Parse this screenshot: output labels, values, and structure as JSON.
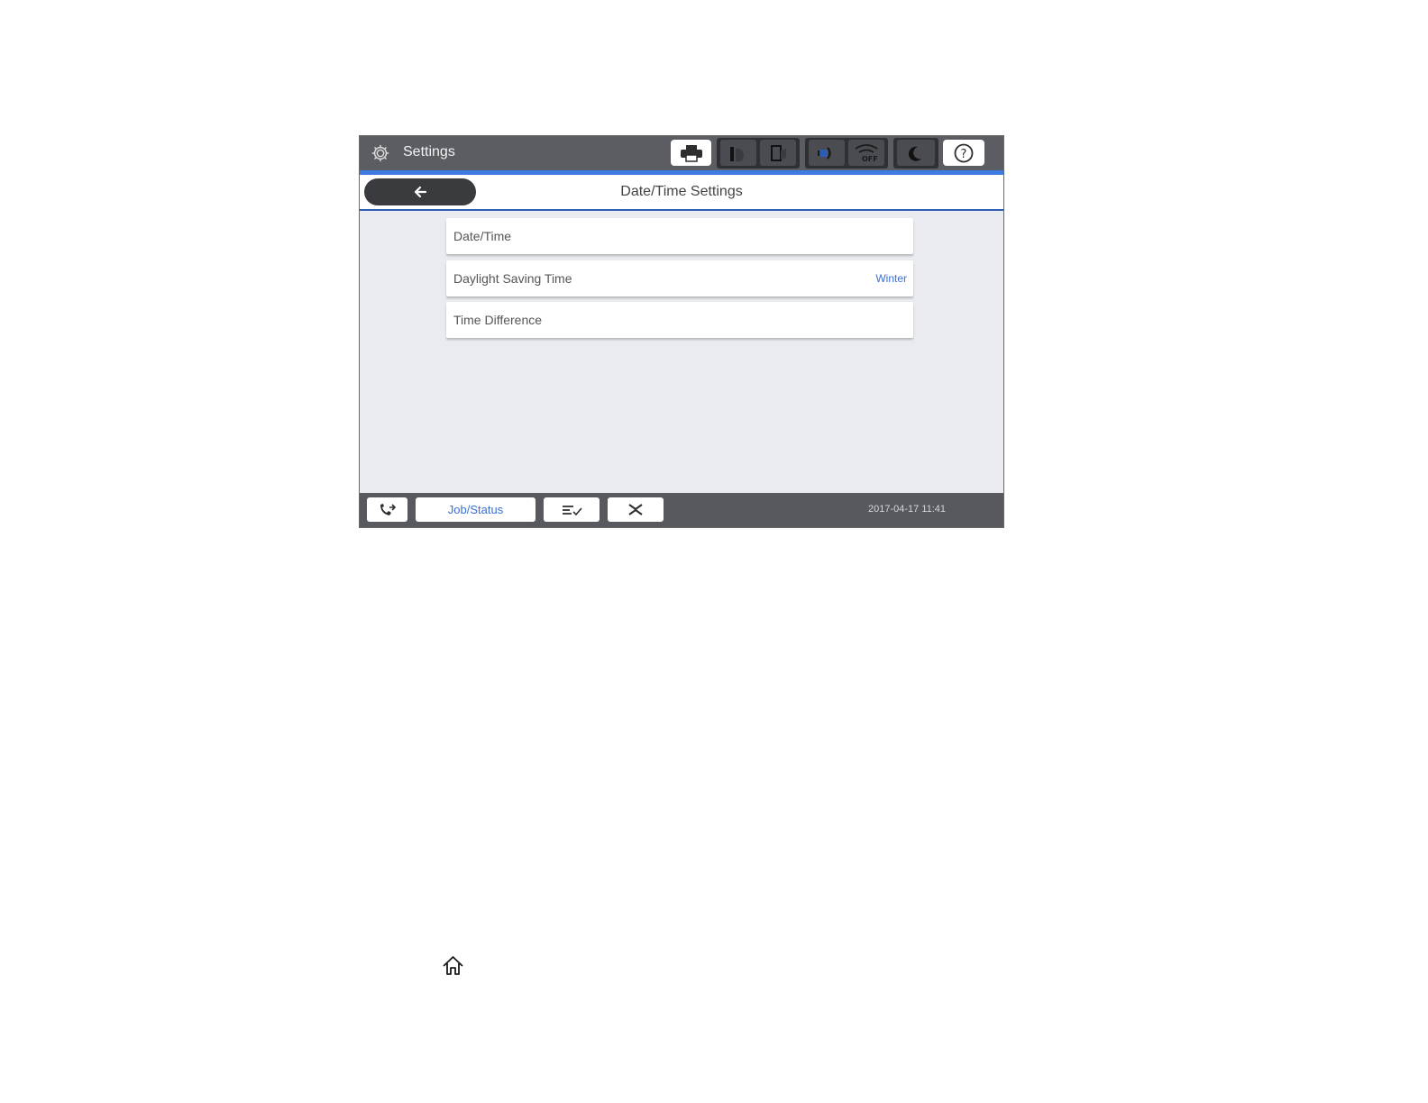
{
  "header": {
    "title": "Settings",
    "icons": [
      "gear-icon",
      "printer-icon",
      "ink-cartridge-icon",
      "maintenance-box-icon",
      "wired-network-icon",
      "wifi-off-icon",
      "sleep-moon-icon",
      "help-icon"
    ],
    "help_label": "?"
  },
  "title_bar": {
    "back_icon": "back-arrow-icon",
    "title": "Date/Time Settings"
  },
  "menu": {
    "items": [
      {
        "label": "Date/Time",
        "value": ""
      },
      {
        "label": "Daylight Saving Time",
        "value": "Winter"
      },
      {
        "label": "Time Difference",
        "value": ""
      }
    ]
  },
  "bottom_bar": {
    "fax_icon": "fax-call-icon",
    "job_status_label": "Job/Status",
    "icons": [
      "job-list-icon",
      "fax-receive-icon"
    ],
    "datetime": "2017-04-17 11:41"
  },
  "page": {
    "home_icon": "home-icon"
  },
  "colors": {
    "topbar": "#5b5d62",
    "accent": "#3f7ae0",
    "background": "#e9ebf0",
    "link": "#3a6fd8"
  }
}
